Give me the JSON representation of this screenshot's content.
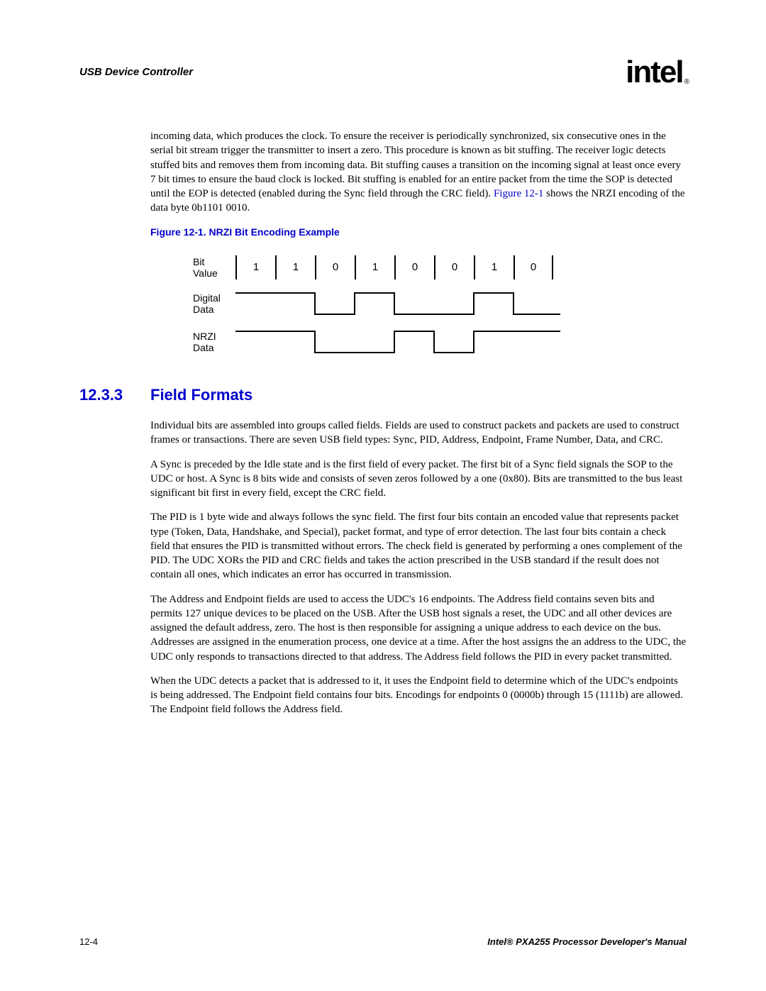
{
  "header": {
    "title": "USB Device Controller",
    "logo_text": "intel",
    "logo_reg": "®"
  },
  "intro_para": "incoming data, which produces the clock. To ensure the receiver is periodically synchronized, six consecutive ones in the serial bit stream trigger the transmitter to insert a zero. This procedure is known as bit stuffing. The receiver logic detects stuffed bits and removes them from incoming data. Bit stuffing causes a transition on the incoming signal at least once every 7 bit times to ensure the baud clock is locked. Bit stuffing is enabled for an entire packet from the time the SOP is detected until the EOP is detected (enabled during the Sync field through the CRC field). ",
  "intro_xref": "Figure 12-1",
  "intro_tail": " shows the NRZI encoding of the data byte 0b1101 0010.",
  "figure": {
    "caption": "Figure 12-1. NRZI Bit Encoding Example",
    "bit_value_label": "Bit\nValue",
    "digital_label": "Digital\nData",
    "nrzi_label": "NRZI\nData",
    "bits": [
      "1",
      "1",
      "0",
      "1",
      "0",
      "0",
      "1",
      "0"
    ]
  },
  "section": {
    "number": "12.3.3",
    "title": "Field Formats",
    "p1": "Individual bits are assembled into groups called fields. Fields are used to construct packets and packets are used to construct frames or transactions. There are seven USB field types: Sync, PID, Address, Endpoint, Frame Number, Data, and CRC.",
    "p2": "A Sync is preceded by the Idle state and is the first field of every packet. The first bit of a Sync field signals the SOP to the UDC or host. A Sync is 8 bits wide and consists of seven zeros followed by a one (0x80). Bits are transmitted to the bus least significant bit first in every field, except the CRC field.",
    "p3": "The PID is 1 byte wide and always follows the sync field. The first four bits contain an encoded value that represents packet type (Token, Data, Handshake, and Special), packet format, and type of error detection. The last four bits contain a check field that ensures the PID is transmitted without errors. The check field is generated by performing a ones complement of the PID. The UDC XORs the PID and CRC fields and takes the action prescribed in the USB standard if the result does not contain all ones, which indicates an error has occurred in transmission.",
    "p4": "The Address and Endpoint fields are used to access the UDC's 16 endpoints. The Address field contains seven bits and permits 127 unique devices to be placed on the USB. After the USB host signals a reset, the UDC and all other devices are assigned the default address, zero. The host is then responsible for assigning a unique address to each device on the bus. Addresses are assigned in the enumeration process, one device at a time. After the host assigns the an address to the UDC, the UDC only responds to transactions directed to that address. The Address field follows the PID in every packet transmitted.",
    "p5": "When the UDC detects a packet that is addressed to it, it uses the Endpoint field to determine which of the UDC's endpoints is being addressed. The Endpoint field contains four bits. Encodings for endpoints 0 (0000b) through 15 (1111b) are allowed. The Endpoint field follows the Address field."
  },
  "footer": {
    "left": "12-4",
    "right": "Intel® PXA255 Processor Developer's Manual"
  }
}
